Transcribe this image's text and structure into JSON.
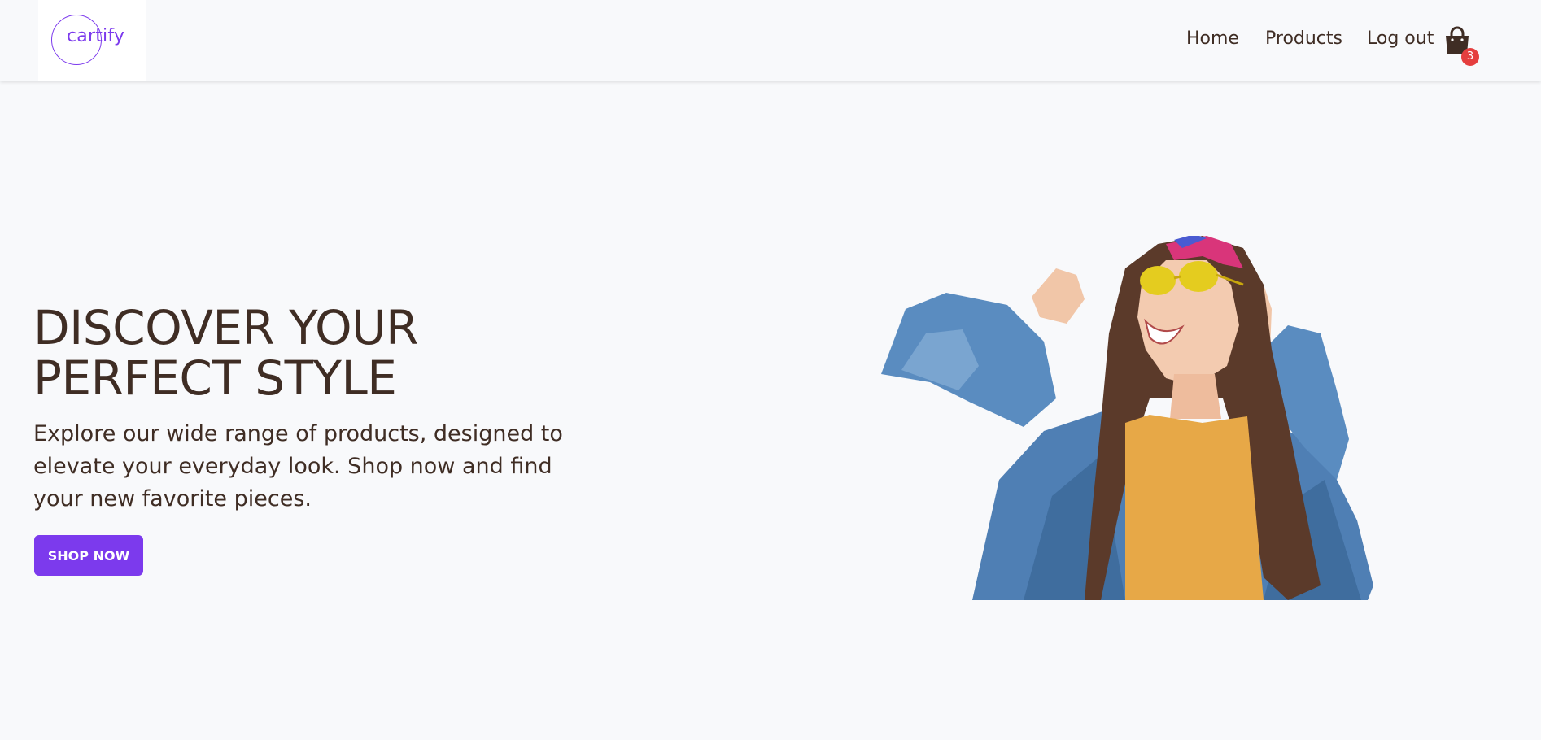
{
  "brand": {
    "logo_text": "cartify",
    "accent": "#7c3aed"
  },
  "nav": {
    "links": [
      {
        "label": "Home"
      },
      {
        "label": "Products"
      },
      {
        "label": "Log out"
      }
    ],
    "cart": {
      "icon": "shopping-bag-icon",
      "count": "3",
      "badge_color": "#e53e3e"
    }
  },
  "hero": {
    "title_line1": "DISCOVER YOUR",
    "title_line2": "PERFECT STYLE",
    "subtitle": "Explore our wide range of products, designed to elevate your everyday look. Shop now and find your new favorite pieces.",
    "cta_label": "SHOP NOW",
    "image_subject": "woman in denim jacket and yellow sunglasses laughing"
  },
  "colors": {
    "background": "#f8f9fb",
    "text": "#3f2d24",
    "button": "#7c3aed"
  }
}
